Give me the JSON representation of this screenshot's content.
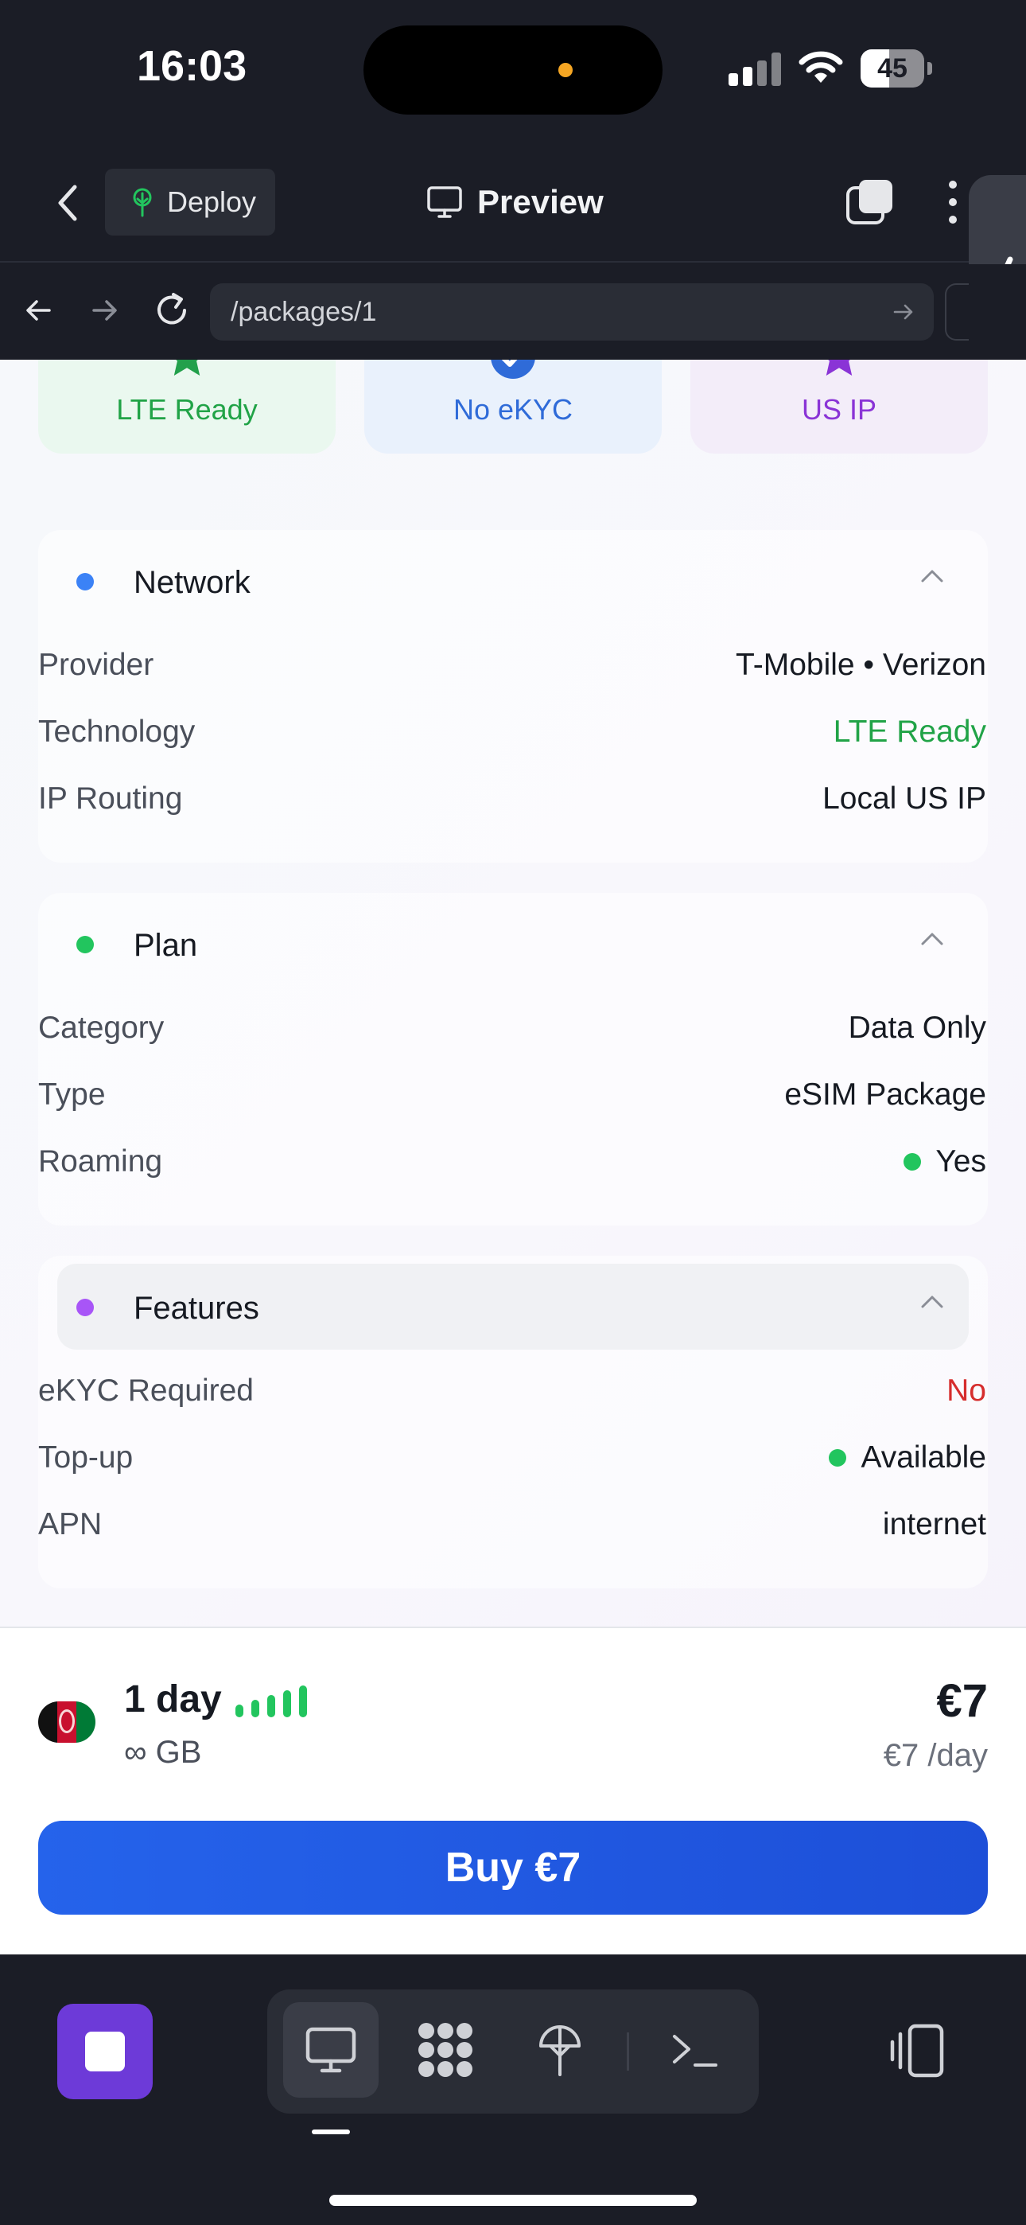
{
  "status_bar": {
    "time": "16:03",
    "battery": "45",
    "battery_level": 0.45
  },
  "header": {
    "deploy_label": "Deploy",
    "title": "Preview"
  },
  "url_bar": {
    "path": "/packages/1"
  },
  "badges": [
    {
      "label": "LTE Ready",
      "color": "#21a347",
      "icon": "star-icon"
    },
    {
      "label": "No eKYC",
      "color": "#2f6bd8",
      "icon": "check-circle-icon"
    },
    {
      "label": "US IP",
      "color": "#8a34d6",
      "icon": "star-icon"
    }
  ],
  "sections": {
    "network": {
      "title": "Network",
      "dot_color": "#3b82f6",
      "rows": [
        {
          "label": "Provider",
          "value": "T-Mobile • Verizon"
        },
        {
          "label": "Technology",
          "value": "LTE Ready"
        },
        {
          "label": "IP Routing",
          "value": "Local US IP"
        }
      ]
    },
    "plan": {
      "title": "Plan",
      "dot_color": "#22c55e",
      "rows": [
        {
          "label": "Category",
          "value": "Data Only"
        },
        {
          "label": "Type",
          "value": "eSIM Package"
        },
        {
          "label": "Roaming",
          "value": "Yes"
        }
      ]
    },
    "features": {
      "title": "Features",
      "dot_color": "#a855f7",
      "rows": [
        {
          "label": "eKYC Required",
          "value": "No"
        },
        {
          "label": "Top-up",
          "value": "Available"
        },
        {
          "label": "APN",
          "value": "internet"
        }
      ]
    }
  },
  "purchase": {
    "duration": "1 day",
    "data": "∞ GB",
    "price": "€7",
    "price_per_day": "€7 /day",
    "buy_label": "Buy €7"
  },
  "colors": {
    "accent": "#2563eb",
    "stop": "#6d3ad8",
    "positive": "#22c55e",
    "negative": "#d62d2d"
  }
}
